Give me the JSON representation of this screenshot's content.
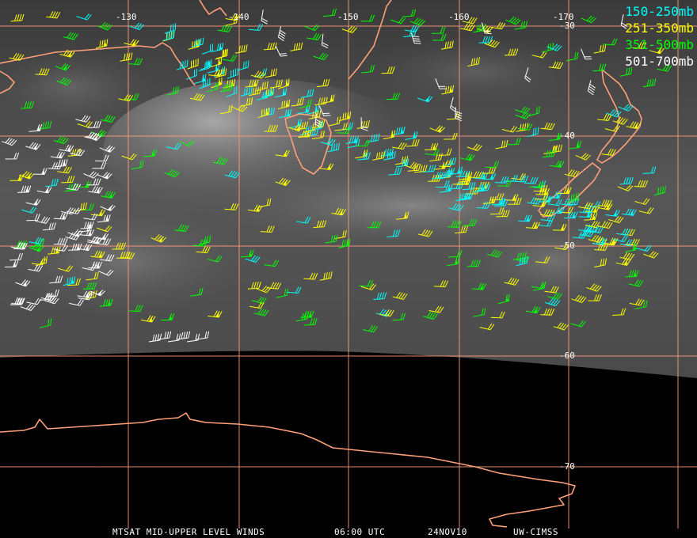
{
  "legend": [
    {
      "label": "150-250mb",
      "color": "#00ffff"
    },
    {
      "label": "251-350mb",
      "color": "#ffff00"
    },
    {
      "label": "351-500mb",
      "color": "#00ff00"
    },
    {
      "label": "501-700mb",
      "color": "#ffffff"
    }
  ],
  "grid": {
    "longitudes": [
      "-130",
      "-140",
      "-150",
      "-160",
      "-170"
    ],
    "latitudes": [
      "-30",
      "-40",
      "-50",
      "-60",
      "-70"
    ]
  },
  "footer": {
    "title": "MTSAT MID-UPPER LEVEL WINDS",
    "time": "06:00 UTC",
    "date": "24NOV10",
    "source": "UW-CIMSS"
  },
  "colors": {
    "grid": "#ff9a7a",
    "coast": "#ffa07a",
    "background": "#000000"
  }
}
